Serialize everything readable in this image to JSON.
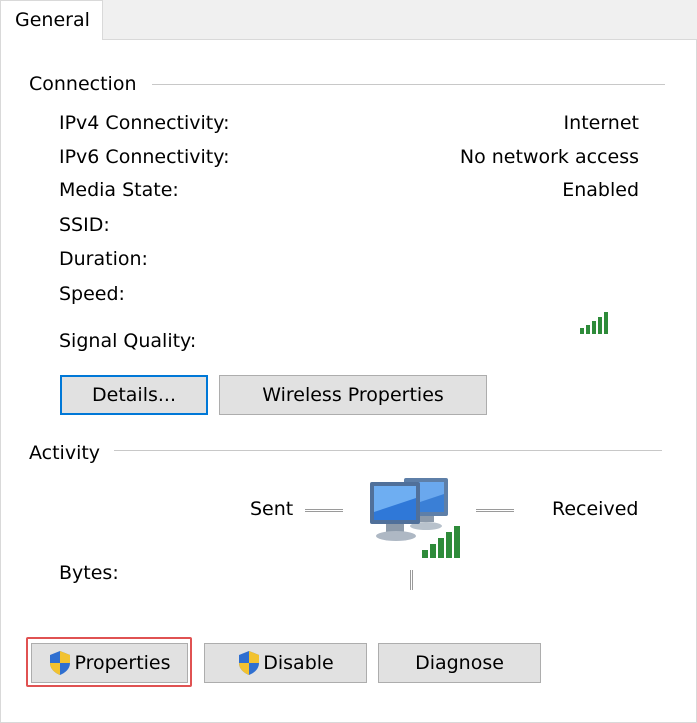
{
  "tabs": [
    {
      "label": "General"
    }
  ],
  "connection": {
    "title": "Connection",
    "rows": [
      {
        "label": "IPv4 Connectivity:",
        "value": "Internet"
      },
      {
        "label": "IPv6 Connectivity:",
        "value": "No network access"
      },
      {
        "label": "Media State:",
        "value": "Enabled"
      },
      {
        "label": "SSID:",
        "value": ""
      },
      {
        "label": "Duration:",
        "value": ""
      },
      {
        "label": "Speed:",
        "value": ""
      },
      {
        "label": "Signal Quality:",
        "value": ""
      }
    ],
    "signal_icon": "signal-bars-icon",
    "details_label": "Details...",
    "wireless_properties_label": "Wireless Properties"
  },
  "activity": {
    "title": "Activity",
    "sent_label": "Sent",
    "received_label": "Received",
    "bytes_label": "Bytes:",
    "network_icon": "network-computers-icon"
  },
  "buttons": {
    "properties_label": "Properties",
    "disable_label": "Disable",
    "diagnose_label": "Diagnose",
    "shield_icon": "uac-shield-icon"
  },
  "colors": {
    "focus_border": "#0078d7",
    "highlight_border": "#e05252",
    "signal_green": "#2e8b3a"
  }
}
